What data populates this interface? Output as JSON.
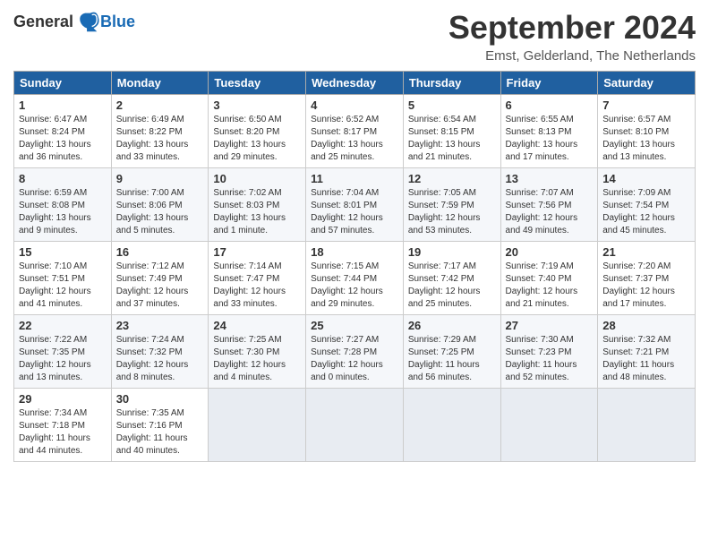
{
  "header": {
    "logo_general": "General",
    "logo_blue": "Blue",
    "month_title": "September 2024",
    "location": "Emst, Gelderland, The Netherlands"
  },
  "columns": [
    "Sunday",
    "Monday",
    "Tuesday",
    "Wednesday",
    "Thursday",
    "Friday",
    "Saturday"
  ],
  "weeks": [
    [
      {
        "day": "1",
        "lines": [
          "Sunrise: 6:47 AM",
          "Sunset: 8:24 PM",
          "Daylight: 13 hours",
          "and 36 minutes."
        ]
      },
      {
        "day": "2",
        "lines": [
          "Sunrise: 6:49 AM",
          "Sunset: 8:22 PM",
          "Daylight: 13 hours",
          "and 33 minutes."
        ]
      },
      {
        "day": "3",
        "lines": [
          "Sunrise: 6:50 AM",
          "Sunset: 8:20 PM",
          "Daylight: 13 hours",
          "and 29 minutes."
        ]
      },
      {
        "day": "4",
        "lines": [
          "Sunrise: 6:52 AM",
          "Sunset: 8:17 PM",
          "Daylight: 13 hours",
          "and 25 minutes."
        ]
      },
      {
        "day": "5",
        "lines": [
          "Sunrise: 6:54 AM",
          "Sunset: 8:15 PM",
          "Daylight: 13 hours",
          "and 21 minutes."
        ]
      },
      {
        "day": "6",
        "lines": [
          "Sunrise: 6:55 AM",
          "Sunset: 8:13 PM",
          "Daylight: 13 hours",
          "and 17 minutes."
        ]
      },
      {
        "day": "7",
        "lines": [
          "Sunrise: 6:57 AM",
          "Sunset: 8:10 PM",
          "Daylight: 13 hours",
          "and 13 minutes."
        ]
      }
    ],
    [
      {
        "day": "8",
        "lines": [
          "Sunrise: 6:59 AM",
          "Sunset: 8:08 PM",
          "Daylight: 13 hours",
          "and 9 minutes."
        ]
      },
      {
        "day": "9",
        "lines": [
          "Sunrise: 7:00 AM",
          "Sunset: 8:06 PM",
          "Daylight: 13 hours",
          "and 5 minutes."
        ]
      },
      {
        "day": "10",
        "lines": [
          "Sunrise: 7:02 AM",
          "Sunset: 8:03 PM",
          "Daylight: 13 hours",
          "and 1 minute."
        ]
      },
      {
        "day": "11",
        "lines": [
          "Sunrise: 7:04 AM",
          "Sunset: 8:01 PM",
          "Daylight: 12 hours",
          "and 57 minutes."
        ]
      },
      {
        "day": "12",
        "lines": [
          "Sunrise: 7:05 AM",
          "Sunset: 7:59 PM",
          "Daylight: 12 hours",
          "and 53 minutes."
        ]
      },
      {
        "day": "13",
        "lines": [
          "Sunrise: 7:07 AM",
          "Sunset: 7:56 PM",
          "Daylight: 12 hours",
          "and 49 minutes."
        ]
      },
      {
        "day": "14",
        "lines": [
          "Sunrise: 7:09 AM",
          "Sunset: 7:54 PM",
          "Daylight: 12 hours",
          "and 45 minutes."
        ]
      }
    ],
    [
      {
        "day": "15",
        "lines": [
          "Sunrise: 7:10 AM",
          "Sunset: 7:51 PM",
          "Daylight: 12 hours",
          "and 41 minutes."
        ]
      },
      {
        "day": "16",
        "lines": [
          "Sunrise: 7:12 AM",
          "Sunset: 7:49 PM",
          "Daylight: 12 hours",
          "and 37 minutes."
        ]
      },
      {
        "day": "17",
        "lines": [
          "Sunrise: 7:14 AM",
          "Sunset: 7:47 PM",
          "Daylight: 12 hours",
          "and 33 minutes."
        ]
      },
      {
        "day": "18",
        "lines": [
          "Sunrise: 7:15 AM",
          "Sunset: 7:44 PM",
          "Daylight: 12 hours",
          "and 29 minutes."
        ]
      },
      {
        "day": "19",
        "lines": [
          "Sunrise: 7:17 AM",
          "Sunset: 7:42 PM",
          "Daylight: 12 hours",
          "and 25 minutes."
        ]
      },
      {
        "day": "20",
        "lines": [
          "Sunrise: 7:19 AM",
          "Sunset: 7:40 PM",
          "Daylight: 12 hours",
          "and 21 minutes."
        ]
      },
      {
        "day": "21",
        "lines": [
          "Sunrise: 7:20 AM",
          "Sunset: 7:37 PM",
          "Daylight: 12 hours",
          "and 17 minutes."
        ]
      }
    ],
    [
      {
        "day": "22",
        "lines": [
          "Sunrise: 7:22 AM",
          "Sunset: 7:35 PM",
          "Daylight: 12 hours",
          "and 13 minutes."
        ]
      },
      {
        "day": "23",
        "lines": [
          "Sunrise: 7:24 AM",
          "Sunset: 7:32 PM",
          "Daylight: 12 hours",
          "and 8 minutes."
        ]
      },
      {
        "day": "24",
        "lines": [
          "Sunrise: 7:25 AM",
          "Sunset: 7:30 PM",
          "Daylight: 12 hours",
          "and 4 minutes."
        ]
      },
      {
        "day": "25",
        "lines": [
          "Sunrise: 7:27 AM",
          "Sunset: 7:28 PM",
          "Daylight: 12 hours",
          "and 0 minutes."
        ]
      },
      {
        "day": "26",
        "lines": [
          "Sunrise: 7:29 AM",
          "Sunset: 7:25 PM",
          "Daylight: 11 hours",
          "and 56 minutes."
        ]
      },
      {
        "day": "27",
        "lines": [
          "Sunrise: 7:30 AM",
          "Sunset: 7:23 PM",
          "Daylight: 11 hours",
          "and 52 minutes."
        ]
      },
      {
        "day": "28",
        "lines": [
          "Sunrise: 7:32 AM",
          "Sunset: 7:21 PM",
          "Daylight: 11 hours",
          "and 48 minutes."
        ]
      }
    ],
    [
      {
        "day": "29",
        "lines": [
          "Sunrise: 7:34 AM",
          "Sunset: 7:18 PM",
          "Daylight: 11 hours",
          "and 44 minutes."
        ]
      },
      {
        "day": "30",
        "lines": [
          "Sunrise: 7:35 AM",
          "Sunset: 7:16 PM",
          "Daylight: 11 hours",
          "and 40 minutes."
        ]
      },
      {
        "day": "",
        "lines": []
      },
      {
        "day": "",
        "lines": []
      },
      {
        "day": "",
        "lines": []
      },
      {
        "day": "",
        "lines": []
      },
      {
        "day": "",
        "lines": []
      }
    ]
  ]
}
